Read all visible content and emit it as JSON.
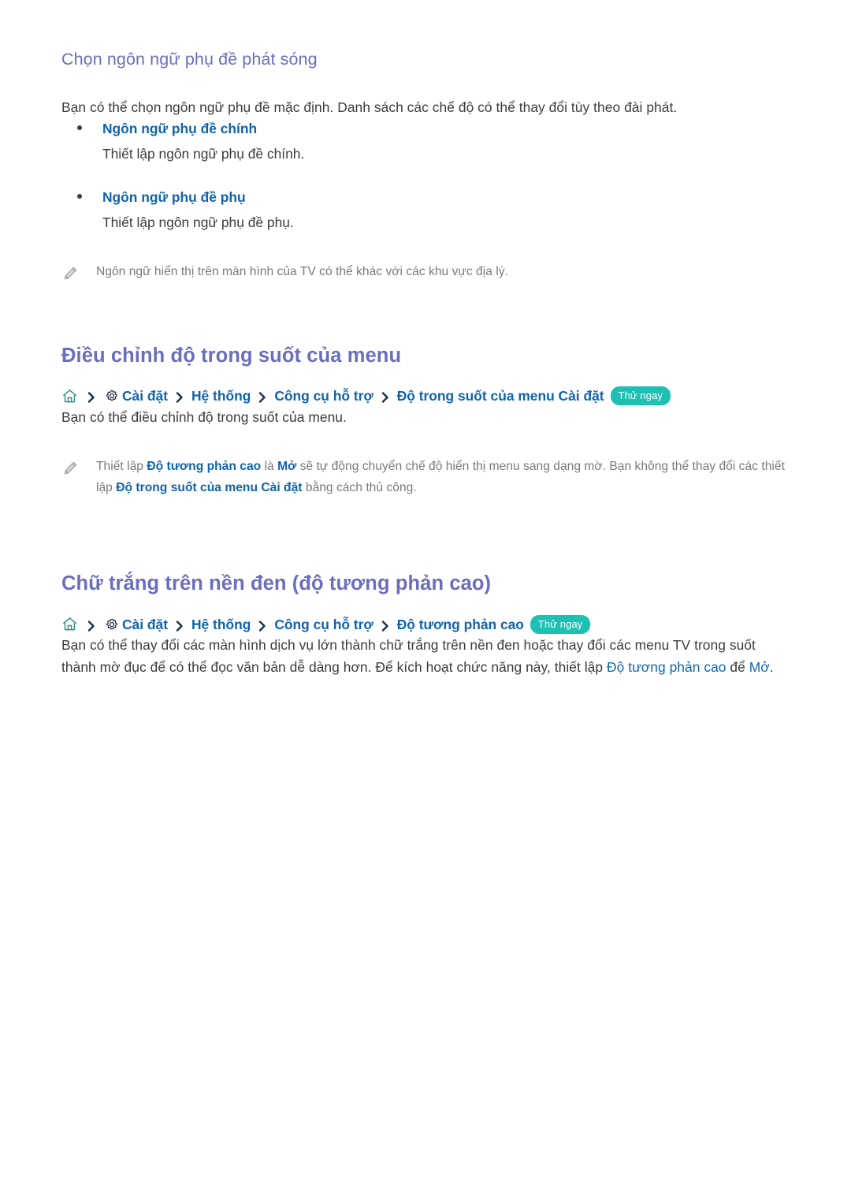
{
  "document": {
    "language": "vi"
  },
  "section_subtitle": {
    "heading": "Chọn ngôn ngữ phụ đề phát sóng",
    "intro": "Bạn có thể chọn ngôn ngữ phụ đề mặc định. Danh sách các chế độ có thể thay đổi tùy theo đài phát.",
    "options": [
      {
        "term": "Ngôn ngữ phụ đề chính",
        "description": "Thiết lập ngôn ngữ phụ đề chính."
      },
      {
        "term": "Ngôn ngữ phụ đề phụ",
        "description": "Thiết lập ngôn ngữ phụ đề phụ."
      }
    ],
    "note": {
      "icon": "pencil-icon",
      "text": "Ngôn ngữ hiển thị trên màn hình của TV có thể khác với các khu vực địa lý."
    }
  },
  "section_menu_transparency": {
    "heading": "Điều chỉnh độ trong suốt của menu",
    "breadcrumb": {
      "home_icon": "home-icon",
      "gear_icon": "gear-icon",
      "separator_icon": "chevron-right-icon",
      "items": [
        "Cài đặt",
        "Hệ thống",
        "Công cụ hỗ trợ",
        "Độ trong suốt của menu Cài đặt"
      ],
      "badge": "Thử ngay"
    },
    "body": "Bạn có thể điều chỉnh độ trong suốt của menu.",
    "note": {
      "icon": "pencil-icon",
      "part1": "Thiết lập ",
      "term1": "Độ tương phản cao",
      "part2": " là ",
      "term2": "Mở",
      "part3": " sẽ tự động chuyển chế độ hiển thị menu sang dạng mờ. Bạn không thể thay đổi các thiết lập ",
      "term3": "Độ trong suốt của menu Cài đặt",
      "part4": " bằng cách thủ công."
    }
  },
  "section_high_contrast": {
    "heading": "Chữ trắng trên nền đen (độ tương phản cao)",
    "breadcrumb": {
      "home_icon": "home-icon",
      "gear_icon": "gear-icon",
      "separator_icon": "chevron-right-icon",
      "items": [
        "Cài đặt",
        "Hệ thống",
        "Công cụ hỗ trợ",
        "Độ tương phản cao"
      ],
      "badge": "Thử ngay"
    },
    "body": {
      "part1": "Bạn có thể thay đổi các màn hình dịch vụ lớn thành chữ trắng trên nền đen hoặc thay đổi các menu TV trong suốt thành mờ đục để có thể đọc văn bản dễ dàng hơn. Để kích hoạt chức năng này, thiết lập ",
      "term1": "Độ tương phản cao",
      "part2": " để ",
      "term2": "Mở",
      "part3": "."
    }
  },
  "colors": {
    "heading_purple": "#6a6fbd",
    "link_blue": "#0f63ad",
    "badge_teal": "#1fc0b4",
    "body_text": "#3c3c3c",
    "note_text": "#7a7a7a",
    "home_icon_teal": "#2f8f86",
    "page_background": "#ffffff"
  }
}
